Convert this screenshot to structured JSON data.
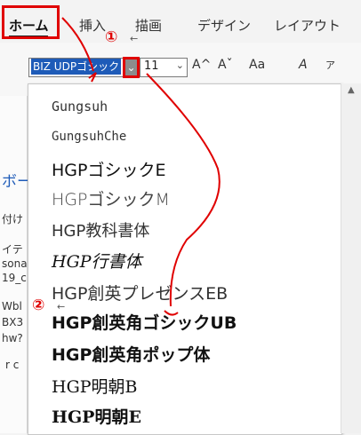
{
  "ribbon": {
    "tabs": [
      "ホーム",
      "挿入",
      "描画",
      "デザイン",
      "レイアウト"
    ]
  },
  "font_name": {
    "value": "BIZ UDPゴシック"
  },
  "font_size": {
    "value": "11"
  },
  "toolbar": {
    "grow_font": "A^",
    "shrink_font": "Aˇ",
    "change_case": "Aa",
    "clear_format": "A"
  },
  "left_pane": {
    "heading": "ボー",
    "lines": [
      "付け",
      "イテ",
      "sona",
      "19_c",
      "Wbl",
      "BX3",
      "hw?",
      "r c"
    ]
  },
  "font_list": [
    "Gungsuh",
    "GungsuhChe",
    "HGPゴシックE",
    "HGPゴシックM",
    "HGP教科書体",
    "HGP行書体",
    "HGP創英プレゼンスEB",
    "HGP創英角ゴシックUB",
    "HGP創英角ポップ体",
    "HGP明朝B",
    "HGP明朝E"
  ],
  "annotations": {
    "step1": "①",
    "step2": "②",
    "arrow": "←"
  },
  "colors": {
    "highlight_red": "#e00000",
    "selection_blue": "#1e5bb8"
  }
}
